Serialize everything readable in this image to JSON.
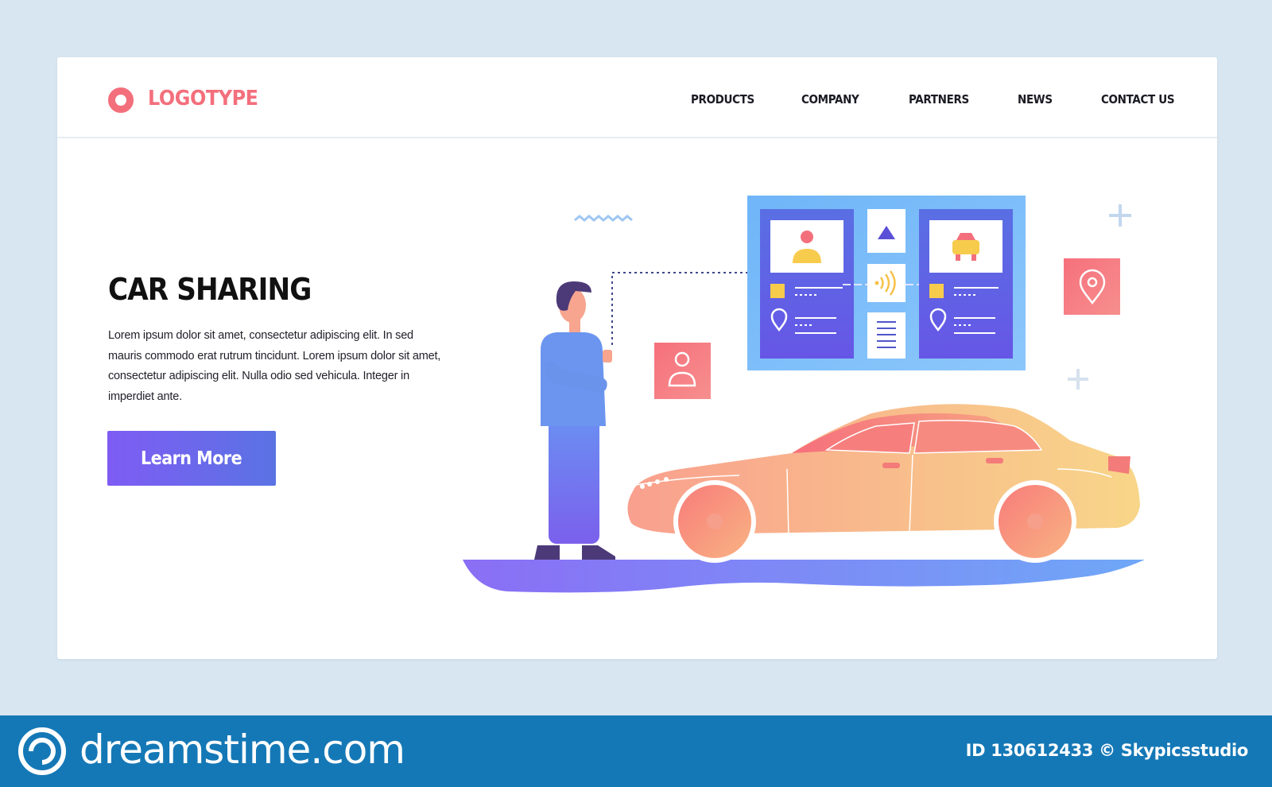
{
  "header": {
    "logo_text": "LOGOTYPE",
    "nav": [
      "PRODUCTS",
      "COMPANY",
      "PARTNERS",
      "NEWS",
      "CONTACT US"
    ]
  },
  "hero": {
    "title": "CAR SHARING",
    "body": "Lorem ipsum dolor sit amet, consectetur adipiscing elit. In sed mauris commodo erat rutrum tincidunt. Lorem ipsum dolor sit amet, consectetur adipiscing elit. Nulla  odio sed vehicula. Integer in imperdiet ante.",
    "cta_label": "Learn More"
  },
  "icons": {
    "logo": "logo-ring-icon",
    "user": "user-icon",
    "location": "location-pin-icon",
    "car": "car-icon",
    "nfc": "nfc-signal-icon",
    "plus": "plus-icon"
  },
  "colors": {
    "brand": "#f36f7c",
    "cta_start": "#7e5cf4",
    "cta_end": "#5a73e3",
    "page_bg": "#d8e6f1",
    "footer_bg": "#1578b6"
  },
  "footer": {
    "brand": "dreamstime.com",
    "id_text": "ID 130612433 © Skypicsstudio"
  }
}
